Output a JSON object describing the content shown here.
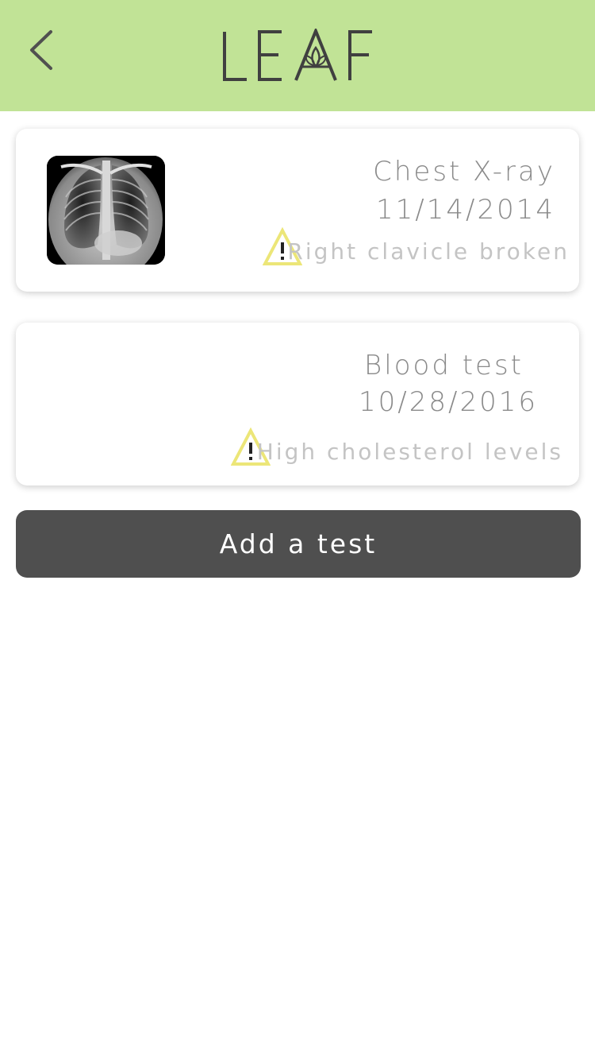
{
  "header": {
    "app_name": "LEAF",
    "background_color": "#c1e396"
  },
  "tests": [
    {
      "name": "Chest X-ray",
      "date": "11/14/2014",
      "alert": "Right clavicle broken",
      "alert_icon": "warning-icon",
      "has_image": true
    },
    {
      "name": "Blood test",
      "date": "10/28/2016",
      "alert": "High cholesterol levels",
      "alert_icon": "warning-icon",
      "has_image": false
    }
  ],
  "actions": {
    "add_test_label": "Add a test"
  },
  "colors": {
    "warning": "#ece678",
    "button": "#4f4f4f",
    "title_text": "#8a8a8a",
    "alert_text": "#c4c4c4"
  }
}
